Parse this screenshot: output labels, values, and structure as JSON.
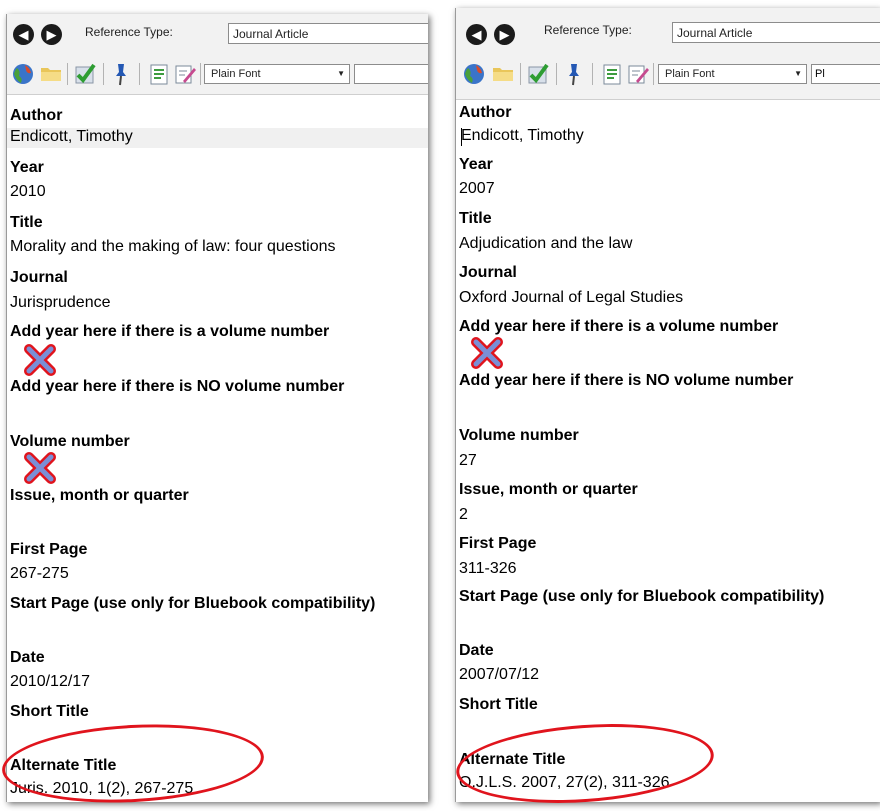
{
  "toolbar": {
    "reference_type_label": "Reference Type:",
    "reference_type_value": "Journal Article",
    "font_value": "Plain Font",
    "font_value_truncated": "Pl"
  },
  "icon_names": [
    "back-arrow-icon",
    "forward-arrow-icon",
    "globe-icon",
    "folder-icon",
    "checkmark-icon",
    "pin-icon",
    "list-icon",
    "edit-icon"
  ],
  "colors": {
    "annotation_red": "#e0141d",
    "cross_fill": "#7a8fd6"
  },
  "left": {
    "fields": [
      {
        "label": "Author",
        "value": "Endicott, Timothy"
      },
      {
        "label": "Year",
        "value": "2010"
      },
      {
        "label": "Title",
        "value": "Morality and the making of law: four questions"
      },
      {
        "label": "Journal",
        "value": "Jurisprudence"
      },
      {
        "label": "Add year here if there is a volume number",
        "value": ""
      },
      {
        "label": "Add year here if there is NO volume number",
        "value": ""
      },
      {
        "label": "Volume number",
        "value": ""
      },
      {
        "label": "Issue, month or quarter",
        "value": ""
      },
      {
        "label": "First Page",
        "value": "267-275"
      },
      {
        "label": "Start Page (use only for Bluebook compatibility)",
        "value": ""
      },
      {
        "label": "Date",
        "value": "2010/12/17"
      },
      {
        "label": "Short Title",
        "value": ""
      },
      {
        "label": "Alternate Title",
        "value": "Juris. 2010, 1(2), 267-275"
      }
    ]
  },
  "right": {
    "fields": [
      {
        "label": "Author",
        "value": "Endicott, Timothy"
      },
      {
        "label": "Year",
        "value": "2007"
      },
      {
        "label": "Title",
        "value": "Adjudication and the law"
      },
      {
        "label": "Journal",
        "value": "Oxford Journal of Legal Studies"
      },
      {
        "label": "Add year here if there is a volume number",
        "value": ""
      },
      {
        "label": "Add year here if there is NO volume number",
        "value": ""
      },
      {
        "label": "Volume number",
        "value": "27"
      },
      {
        "label": "Issue, month or quarter",
        "value": "2"
      },
      {
        "label": "First Page",
        "value": "311-326"
      },
      {
        "label": "Start Page (use only for Bluebook compatibility)",
        "value": ""
      },
      {
        "label": "Date",
        "value": "2007/07/12"
      },
      {
        "label": "Short Title",
        "value": ""
      },
      {
        "label": "Alternate Title",
        "value": "O.J.L.S. 2007, 27(2), 311-326"
      }
    ]
  }
}
